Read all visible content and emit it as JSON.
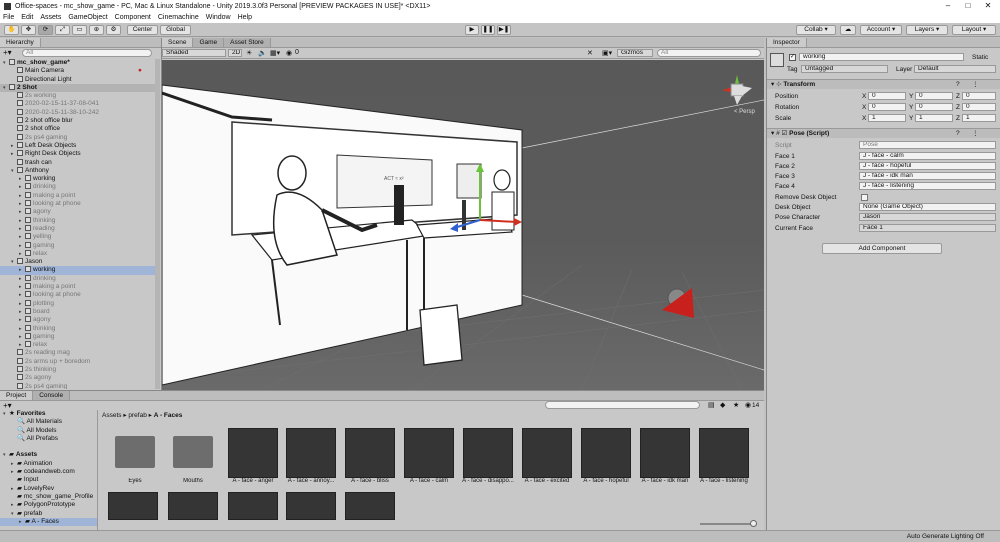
{
  "window": {
    "title": "Office-spaces - mc_show_game - PC, Mac & Linux Standalone - Unity 2019.3.0f3 Personal [PREVIEW PACKAGES IN USE]* <DX11>"
  },
  "menu": [
    "File",
    "Edit",
    "Assets",
    "GameObject",
    "Component",
    "Cinemachine",
    "Window",
    "Help"
  ],
  "toolbar": {
    "center": "Center",
    "global": "Global",
    "collab": "Collab ▾",
    "account": "Account ▾",
    "layers": "Layers ▾",
    "layout": "Layout ▾"
  },
  "hierarchy": {
    "tab": "Hierarchy",
    "search_placeholder": "All",
    "items": [
      {
        "label": "mc_show_game*",
        "state": "scene"
      },
      {
        "label": "Main Camera",
        "state": "normal"
      },
      {
        "label": "Directional Light",
        "state": "normal"
      },
      {
        "label": "2 Shot",
        "state": "header"
      },
      {
        "label": "2s working",
        "state": "dim"
      },
      {
        "label": "2020-02-15-11-37-08-041",
        "state": "dim"
      },
      {
        "label": "2020-02-15-11-38-10-242",
        "state": "dim"
      },
      {
        "label": "2 shot office blur",
        "state": "normal"
      },
      {
        "label": "2 shot office",
        "state": "normal"
      },
      {
        "label": "2s ps4 gaming",
        "state": "dim"
      },
      {
        "label": "Left Desk Objects",
        "state": "normal"
      },
      {
        "label": "Right Desk Objects",
        "state": "normal"
      },
      {
        "label": "trash can",
        "state": "normal"
      },
      {
        "label": "Anthony",
        "state": "normal"
      },
      {
        "label": "working",
        "state": "normal"
      },
      {
        "label": "drinking",
        "state": "dim"
      },
      {
        "label": "making a point",
        "state": "dim"
      },
      {
        "label": "looking at phone",
        "state": "dim"
      },
      {
        "label": "agony",
        "state": "dim"
      },
      {
        "label": "thinking",
        "state": "dim"
      },
      {
        "label": "reading",
        "state": "dim"
      },
      {
        "label": "yelling",
        "state": "dim"
      },
      {
        "label": "gaming",
        "state": "dim"
      },
      {
        "label": "relax",
        "state": "dim"
      },
      {
        "label": "Jason",
        "state": "normal"
      },
      {
        "label": "working",
        "state": "selected"
      },
      {
        "label": "drinking",
        "state": "dim"
      },
      {
        "label": "making a point",
        "state": "dim"
      },
      {
        "label": "looking at phone",
        "state": "dim"
      },
      {
        "label": "plotting",
        "state": "dim"
      },
      {
        "label": "board",
        "state": "dim"
      },
      {
        "label": "agony",
        "state": "dim"
      },
      {
        "label": "thinking",
        "state": "dim"
      },
      {
        "label": "gaming",
        "state": "dim"
      },
      {
        "label": "relax",
        "state": "dim"
      },
      {
        "label": "2s reading mag",
        "state": "dim"
      },
      {
        "label": "2s arms up + boredom",
        "state": "dim"
      },
      {
        "label": "2s thinking",
        "state": "dim"
      },
      {
        "label": "2s agony",
        "state": "dim"
      },
      {
        "label": "2s ps4 gaming",
        "state": "dim"
      }
    ]
  },
  "scene": {
    "tabs": [
      "Scene",
      "Game",
      "Asset Store"
    ],
    "shaded": "Shaded",
    "mode2d": "2D",
    "gizmos": "Gizmos",
    "search_placeholder": "All",
    "persp": "< Persp",
    "fx_count": "0"
  },
  "inspector": {
    "tab": "Inspector",
    "name": "working",
    "static": "Static",
    "tag_label": "Tag",
    "tag": "Untagged",
    "layer_label": "Layer",
    "layer": "Default",
    "transform": {
      "title": "Transform",
      "rows": [
        {
          "label": "Position",
          "x": "0",
          "y": "0",
          "z": "0"
        },
        {
          "label": "Rotation",
          "x": "0",
          "y": "0",
          "z": "0"
        },
        {
          "label": "Scale",
          "x": "1",
          "y": "1",
          "z": "1"
        }
      ]
    },
    "pose": {
      "title": "Pose (Script)",
      "script_label": "Script",
      "script": "Pose",
      "fields": [
        {
          "label": "Face 1",
          "value": "J - face - calm"
        },
        {
          "label": "Face 2",
          "value": "J - face - hopeful"
        },
        {
          "label": "Face 3",
          "value": "J - face - idk man"
        },
        {
          "label": "Face 4",
          "value": "J - face - listening"
        }
      ],
      "remove_label": "Remove Desk Object",
      "desk_label": "Desk Object",
      "desk": "None (Game Object)",
      "pc_label": "Pose Character",
      "pc": "Jason",
      "cf_label": "Current Face",
      "cf": "Face 1"
    },
    "add_component": "Add Component"
  },
  "project": {
    "tabs": [
      "Project",
      "Console"
    ],
    "breadcrumb": [
      "Assets",
      "prefab",
      "A - Faces"
    ],
    "badge": "14",
    "favorites": {
      "title": "Favorites",
      "items": [
        "All Materials",
        "All Models",
        "All Prefabs"
      ]
    },
    "assets": {
      "title": "Assets",
      "items": [
        "Animation",
        "codeandweb.com",
        "Input",
        "LovelyRev",
        "mc_show_game_Profile",
        "PolygonPrototype",
        "prefab",
        "A - Faces"
      ]
    },
    "grid": [
      "Eyes",
      "Mouths",
      "A - face - anger",
      "A - face - annoy...",
      "A - face - bliss",
      "A - face - calm",
      "A - face - disappo...",
      "A - face - excited",
      "A - face - hopeful",
      "A - face - idk man",
      "A - face - listening"
    ]
  },
  "status": "Auto Generate Lighting Off",
  "colors": {
    "scene_bg": "#565656",
    "selection": "#9fb4d6",
    "gizmo_red": "#c8201c"
  }
}
